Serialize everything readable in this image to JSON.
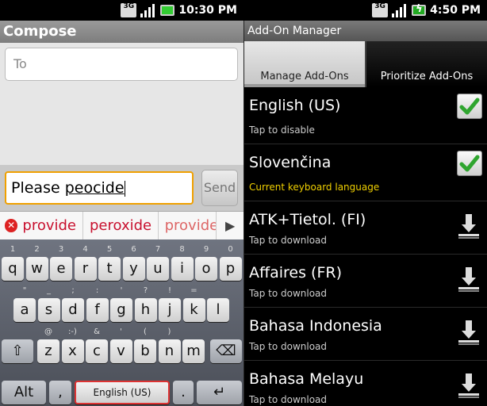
{
  "left_status": {
    "network": "3G",
    "time": "10:30 PM"
  },
  "right_status": {
    "network": "3G",
    "time": "4:50 PM"
  },
  "compose": {
    "title": "Compose",
    "to_placeholder": "To",
    "message_prefix": "Please ",
    "message_word": "peocide",
    "send_label": "Send"
  },
  "suggestions": [
    "provide",
    "peroxide",
    "provide"
  ],
  "keyboard": {
    "row1": [
      [
        "q",
        "1"
      ],
      [
        "w",
        "2"
      ],
      [
        "e",
        "3"
      ],
      [
        "r",
        "4"
      ],
      [
        "t",
        "5"
      ],
      [
        "y",
        "6"
      ],
      [
        "u",
        "7"
      ],
      [
        "i",
        "8"
      ],
      [
        "o",
        "9"
      ],
      [
        "p",
        "0"
      ]
    ],
    "row2": [
      [
        "a",
        "\""
      ],
      [
        "s",
        "_"
      ],
      [
        "d",
        ";"
      ],
      [
        "f",
        ":"
      ],
      [
        "g",
        "'"
      ],
      [
        "h",
        "?"
      ],
      [
        "j",
        "!"
      ],
      [
        "k",
        "="
      ],
      [
        "l",
        ""
      ]
    ],
    "row3": [
      [
        "z",
        "@"
      ],
      [
        "x",
        ":-)"
      ],
      [
        "c",
        "&"
      ],
      [
        "v",
        "'"
      ],
      [
        "b",
        "("
      ],
      [
        "n",
        ")"
      ],
      [
        "m",
        ""
      ]
    ],
    "alt_label": "Alt",
    "space_label": "English (US)",
    "period_label": ".",
    "comma_label": ","
  },
  "addon_manager": {
    "title": "Add-On Manager",
    "tabs": [
      "Manage Add-Ons",
      "Prioritize Add-Ons"
    ],
    "items": [
      {
        "name": "English (US)",
        "sub": "Tap to disable",
        "state": "checked"
      },
      {
        "name": "Slovenčina",
        "sub": "Current keyboard language",
        "state": "checked"
      },
      {
        "name": "ATK+Tietol. (FI)",
        "sub": "Tap to download",
        "state": "download"
      },
      {
        "name": "Affaires (FR)",
        "sub": "Tap to download",
        "state": "download"
      },
      {
        "name": "Bahasa Indonesia",
        "sub": "Tap to download",
        "state": "download"
      },
      {
        "name": "Bahasa Melayu",
        "sub": "Tap to download",
        "state": "download"
      }
    ]
  },
  "colors": {
    "suggestion_text": "#c8102e",
    "input_focus": "#f0a000",
    "check_green": "#2fa52f",
    "current_language": "#f0d000"
  }
}
